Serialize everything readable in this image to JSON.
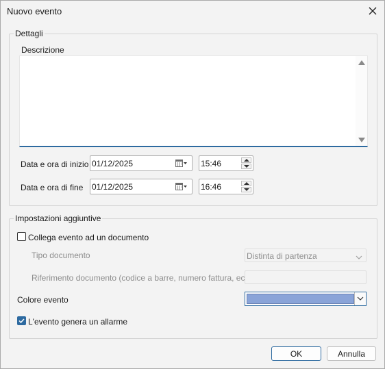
{
  "dialog": {
    "title": "Nuovo evento"
  },
  "details": {
    "legend": "Dettagli",
    "description_label": "Descrizione",
    "description_value": "",
    "start_label": "Data e ora di inizio",
    "start_date": "01/12/2025",
    "start_time": "15:46",
    "end_label": "Data e ora di fine",
    "end_date": "01/12/2025",
    "end_time": "16:46"
  },
  "additional": {
    "legend": "Impostazioni aggiuntive",
    "link_document_label": "Collega evento ad un documento",
    "link_document_checked": false,
    "document_type_label": "Tipo documento",
    "document_type_value": "Distinta di partenza",
    "document_ref_label": "Riferimento documento (codice a barre, numero fattura, ecc.)",
    "document_ref_value": "",
    "color_label": "Colore evento",
    "color_value": "#8aa4d8",
    "alarm_label": "L'evento genera un allarme",
    "alarm_checked": true
  },
  "buttons": {
    "ok": "OK",
    "cancel": "Annulla"
  },
  "colors": {
    "accent": "#2d6aa0",
    "window_bg": "#f3f3f3"
  }
}
